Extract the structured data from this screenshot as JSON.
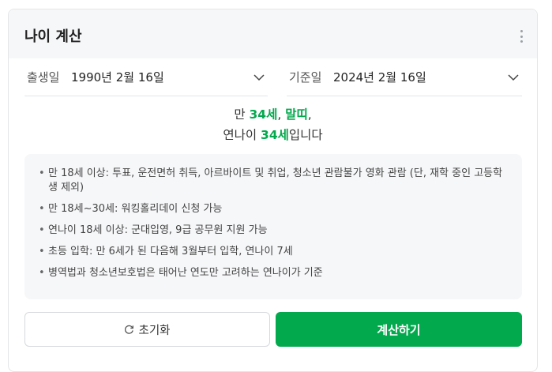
{
  "title": "나이 계산",
  "birth": {
    "label": "출생일",
    "value": "1990년 2월 16일"
  },
  "base": {
    "label": "기준일",
    "value": "2024년 2월 16일"
  },
  "result": {
    "line1_prefix": "만 ",
    "age_full": "34세",
    "sep": ", ",
    "zodiac": "말띠",
    "comma": ",",
    "line2_prefix": "연나이 ",
    "age_year": "34세",
    "line2_suffix": "입니다"
  },
  "info_items": [
    "만 18세 이상: 투표, 운전면허 취득, 아르바이트 및 취업, 청소년 관람불가 영화 관람 (단, 재학 중인 고등학생 제외)",
    "만 18세~30세: 워킹홀리데이 신청 가능",
    "연나이 18세 이상: 군대입영, 9급 공무원 지원 가능",
    "초등 입학: 만 6세가 된 다음해 3월부터 입학, 연나이 7세",
    "병역법과 청소년보호법은 태어난 연도만 고려하는 연나이가 기준"
  ],
  "buttons": {
    "reset": "초기화",
    "calculate": "계산하기"
  },
  "colors": {
    "accent": "#03a94d"
  },
  "icons": {
    "more": "more-vertical-icon",
    "chevron": "chevron-down-icon",
    "reset": "refresh-icon"
  }
}
